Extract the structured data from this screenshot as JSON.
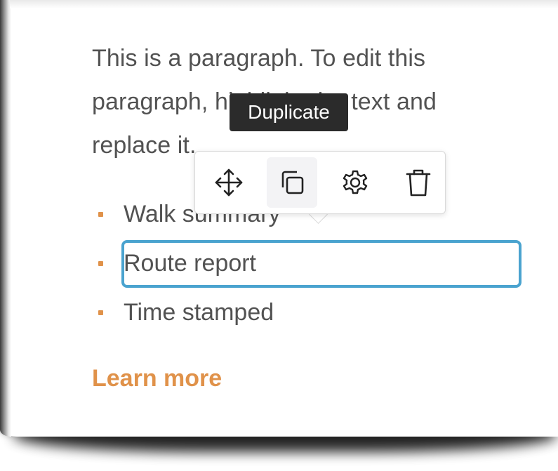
{
  "paragraph": {
    "text": "This is a paragraph. To edit this paragraph, highlight the text and replace it."
  },
  "list": {
    "items": [
      {
        "label": "Walk summary"
      },
      {
        "label": "Route report",
        "selected": true
      },
      {
        "label": "Time stamped"
      }
    ]
  },
  "link": {
    "label": "Learn more"
  },
  "toolbar": {
    "buttons": [
      {
        "icon": "move-icon",
        "active": false
      },
      {
        "icon": "duplicate-icon",
        "active": true
      },
      {
        "icon": "gear-icon",
        "active": false
      },
      {
        "icon": "trash-icon",
        "active": false
      }
    ],
    "tooltip": "Duplicate"
  },
  "colors": {
    "accent": "#e0924a",
    "selection_border": "#4aa3cf",
    "body_text": "#525252",
    "tooltip_bg": "#2b2b2b"
  }
}
